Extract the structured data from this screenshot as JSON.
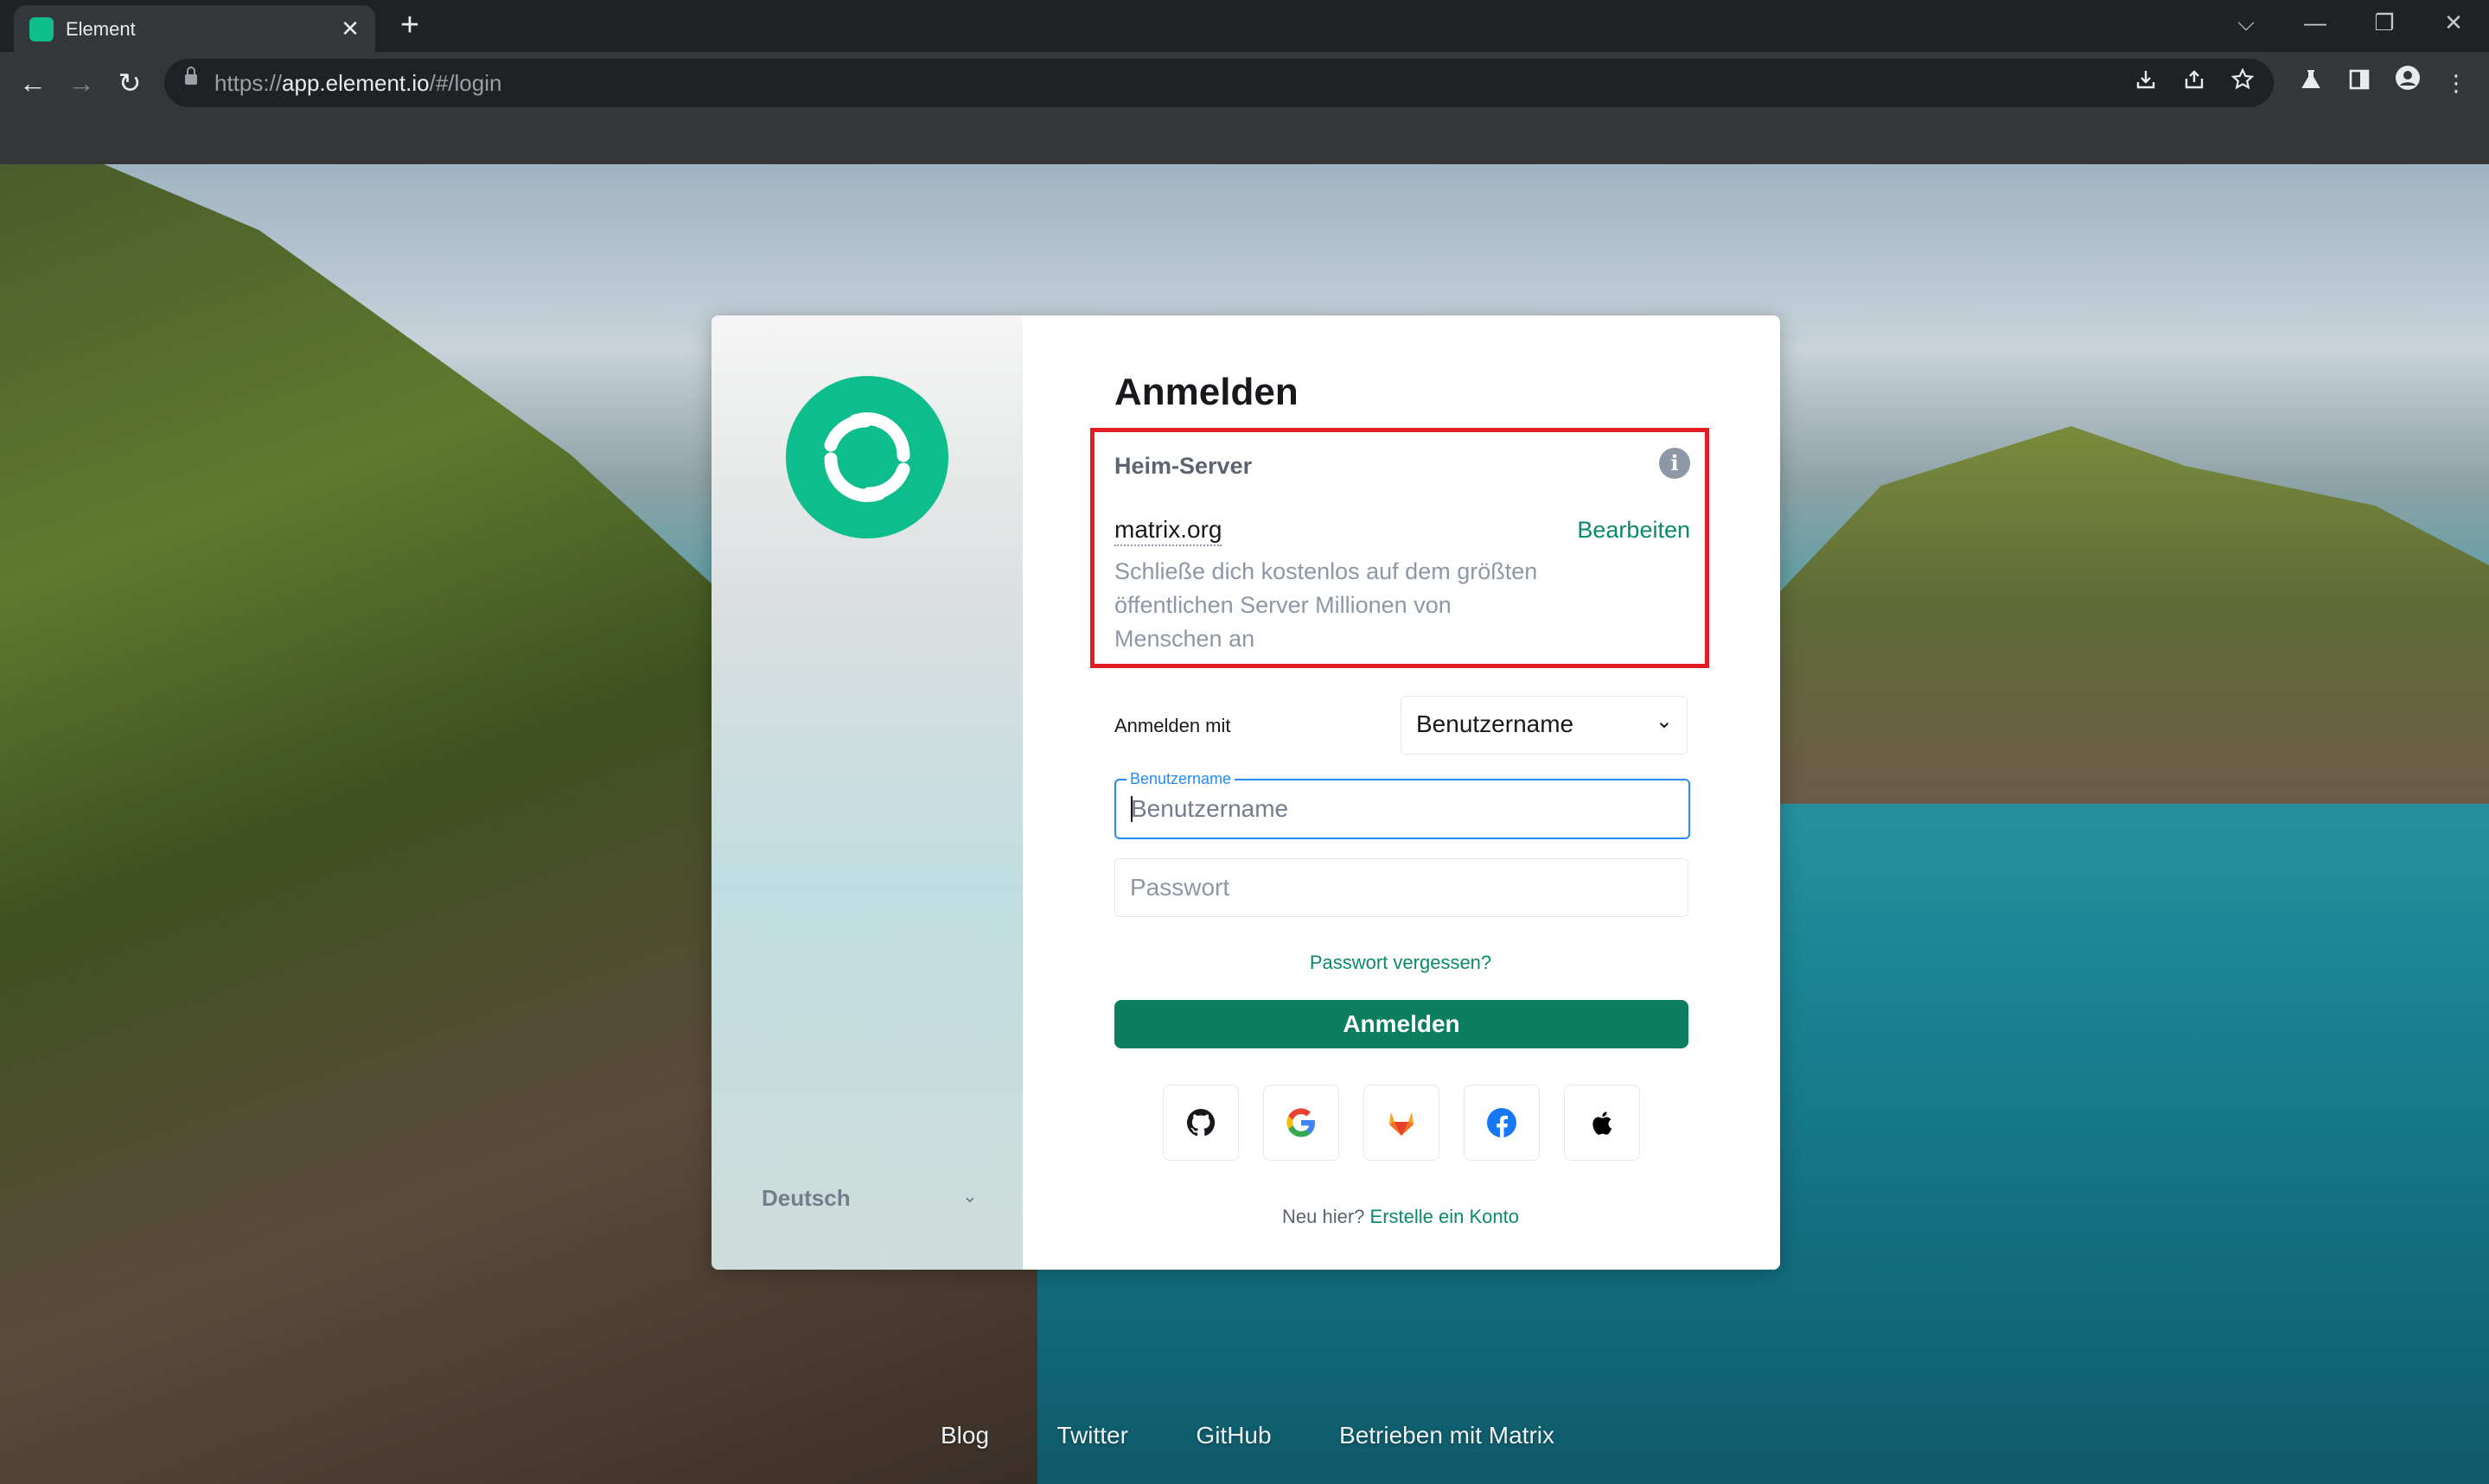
{
  "browser": {
    "tab_title": "Element",
    "tab_close": "✕",
    "new_tab": "+",
    "url_scheme": "https://",
    "url_host": "app.element.io",
    "url_path": "/#/login",
    "window_controls": {
      "dropdown": "⌵",
      "minimize": "—",
      "restore": "❐",
      "close": "✕"
    },
    "nav": {
      "back": "←",
      "forward": "→",
      "reload": "↻"
    }
  },
  "sidebar": {
    "language": "Deutsch"
  },
  "login": {
    "title": "Anmelden",
    "homeserver": {
      "heading": "Heim-Server",
      "name": "matrix.org",
      "edit_label": "Bearbeiten",
      "description": "Schließe dich kostenlos auf dem größten öffentlichen Server Millionen von Menschen an"
    },
    "login_with_label": "Anmelden mit",
    "login_with_value": "Benutzername",
    "username_label": "Benutzername",
    "username_placeholder": "Benutzername",
    "password_placeholder": "Passwort",
    "forgot_password": "Passwort vergessen?",
    "submit": "Anmelden",
    "sso_providers": [
      "GitHub",
      "Google",
      "GitLab",
      "Facebook",
      "Apple"
    ],
    "signup_prompt": "Neu hier?",
    "signup_link": "Erstelle ein Konto"
  },
  "footer": {
    "links": [
      "Blog",
      "Twitter",
      "GitHub",
      "Betrieben mit Matrix"
    ]
  },
  "colors": {
    "accent": "#0dbd8b",
    "button": "#0b7e5d",
    "highlight_box": "#e21d25",
    "focus": "#238cf5"
  }
}
